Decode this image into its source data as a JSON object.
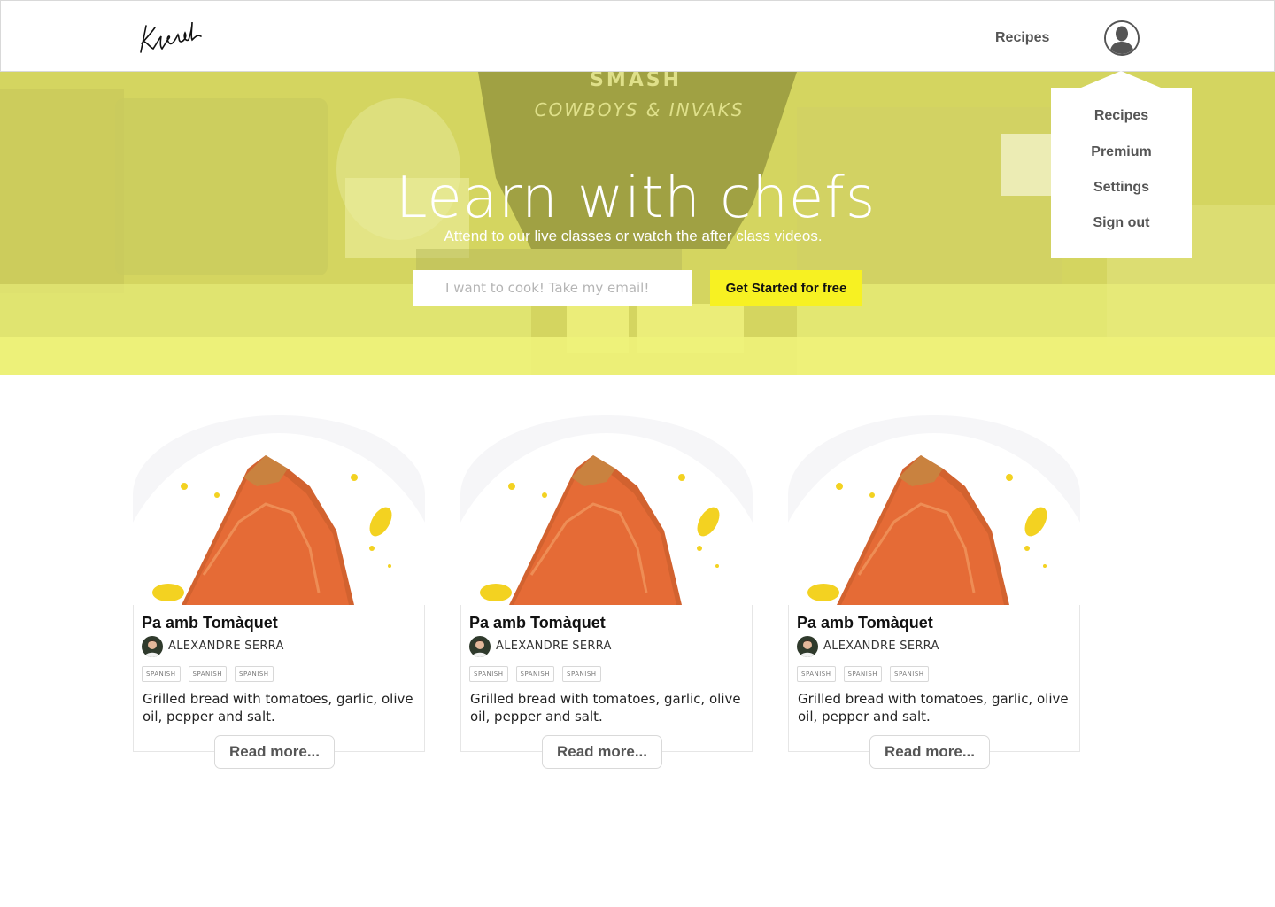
{
  "header": {
    "logo_text": "Kyde",
    "nav_recipes": "Recipes"
  },
  "dropdown": {
    "items": [
      "Recipes",
      "Premium",
      "Settings",
      "Sign out"
    ]
  },
  "hero": {
    "title": "Learn with chefs",
    "subtitle": "Attend to our live classes or watch the after class videos.",
    "email_placeholder": "I want to cook! Take my email!",
    "cta_label": "Get Started for free",
    "background_text_line1": "SMASH",
    "background_text_line2": "COWBOYS & INVAKS"
  },
  "cards": [
    {
      "title": "Pa amb Tomàquet",
      "chef": "ALEXANDRE SERRA",
      "tags": [
        "SPANISH",
        "SPANISH",
        "SPANISH"
      ],
      "description": "Grilled bread with tomatoes, garlic, olive oil, pepper and salt.",
      "button": "Read more..."
    },
    {
      "title": "Pa amb Tomàquet",
      "chef": "ALEXANDRE SERRA",
      "tags": [
        "SPANISH",
        "SPANISH",
        "SPANISH"
      ],
      "description": "Grilled bread with tomatoes, garlic, olive oil, pepper and salt.",
      "button": "Read more..."
    },
    {
      "title": "Pa amb Tomàquet",
      "chef": "ALEXANDRE SERRA",
      "tags": [
        "SPANISH",
        "SPANISH",
        "SPANISH"
      ],
      "description": "Grilled bread with tomatoes, garlic, olive oil, pepper and salt.",
      "button": "Read more..."
    }
  ],
  "colors": {
    "accent": "#f7f122",
    "hero_tint": "#dfe36c",
    "nav_text": "#555555"
  },
  "icons": {
    "avatar": "user-silhouette-icon",
    "logo": "signature-logo"
  }
}
